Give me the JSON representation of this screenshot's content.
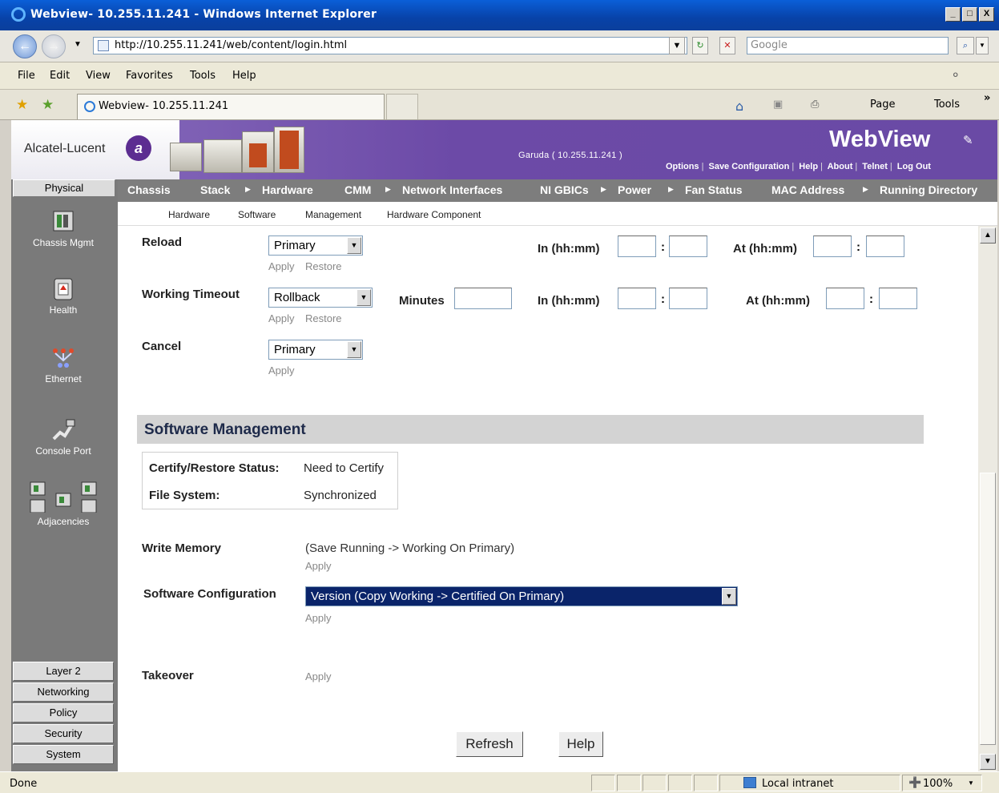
{
  "window": {
    "title": "Webview- 10.255.11.241 - Windows Internet Explorer",
    "min_label": "_",
    "max_label": "□",
    "close_label": "X"
  },
  "address_bar": {
    "url": "http://10.255.11.241/web/content/login.html",
    "search_placeholder": "Google",
    "dropdown_glyph": "▼",
    "refresh_glyph": "↻",
    "stop_glyph": "✕",
    "search_glyph": "⌕"
  },
  "menu": {
    "items": [
      "File",
      "Edit",
      "View",
      "Favorites",
      "Tools",
      "Help"
    ]
  },
  "tab": {
    "title": "Webview- 10.255.11.241"
  },
  "command_bar": {
    "home_glyph": "⌂",
    "page_label": "Page",
    "tools_label": "Tools",
    "chevron_glyph": "»"
  },
  "header": {
    "brand": "Alcatel-Lucent",
    "host": "Garuda ( 10.255.11.241 )",
    "app_title": "WebView",
    "links": [
      "Options",
      "Save Configuration",
      "Help",
      "About",
      "Telnet",
      "Log Out"
    ]
  },
  "left_nav": {
    "top_button": "Physical",
    "icons": [
      {
        "label": "Chassis Mgmt",
        "icon": "chassis-icon"
      },
      {
        "label": "Health",
        "icon": "health-icon"
      },
      {
        "label": "Ethernet",
        "icon": "ethernet-icon"
      },
      {
        "label": "Console Port",
        "icon": "console-port-icon"
      },
      {
        "label": "Adjacencies",
        "icon": "adjacencies-icon"
      }
    ],
    "categories": [
      "Layer 2",
      "Networking",
      "Policy",
      "Security",
      "System"
    ]
  },
  "main_nav": {
    "items": [
      "Chassis",
      "Stack",
      "Hardware",
      "CMM",
      "Network Interfaces",
      "NI GBICs",
      "Power",
      "Fan Status",
      "MAC Address",
      "Running Directory"
    ]
  },
  "sub_nav": {
    "items": [
      "Hardware",
      "Software",
      "Management",
      "Hardware Component"
    ]
  },
  "form": {
    "reload": {
      "label": "Reload",
      "select": "Primary",
      "apply": "Apply",
      "restore": "Restore",
      "in_label": "In (hh:mm)",
      "at_label": "At (hh:mm)"
    },
    "working_timeout": {
      "label": "Working Timeout",
      "select": "Rollback",
      "apply": "Apply",
      "restore": "Restore",
      "minutes_label": "Minutes",
      "in_label": "In (hh:mm)",
      "at_label": "At (hh:mm)"
    },
    "cancel": {
      "label": "Cancel",
      "select": "Primary",
      "apply": "Apply"
    },
    "colon": ":"
  },
  "software_management": {
    "title": "Software Management",
    "status_label": "Certify/Restore Status:",
    "status_value": "Need to Certify",
    "fs_label": "File System:",
    "fs_value": "Synchronized",
    "write_memory_label": "Write Memory",
    "write_memory_desc": "(Save Running -> Working On Primary)",
    "write_memory_apply": "Apply",
    "sw_config_label": "Software Configuration",
    "sw_config_value": "Version (Copy Working -> Certified On Primary)",
    "sw_config_apply": "Apply",
    "takeover_label": "Takeover",
    "takeover_apply": "Apply"
  },
  "buttons": {
    "refresh": "Refresh",
    "help": "Help"
  },
  "status_bar": {
    "text": "Done",
    "zone": "Local intranet",
    "zoom": "100%"
  },
  "colors": {
    "header_purple": "#6c4aa7",
    "nav_gray": "#7d7d7d",
    "selected_blue": "#0a246a"
  }
}
